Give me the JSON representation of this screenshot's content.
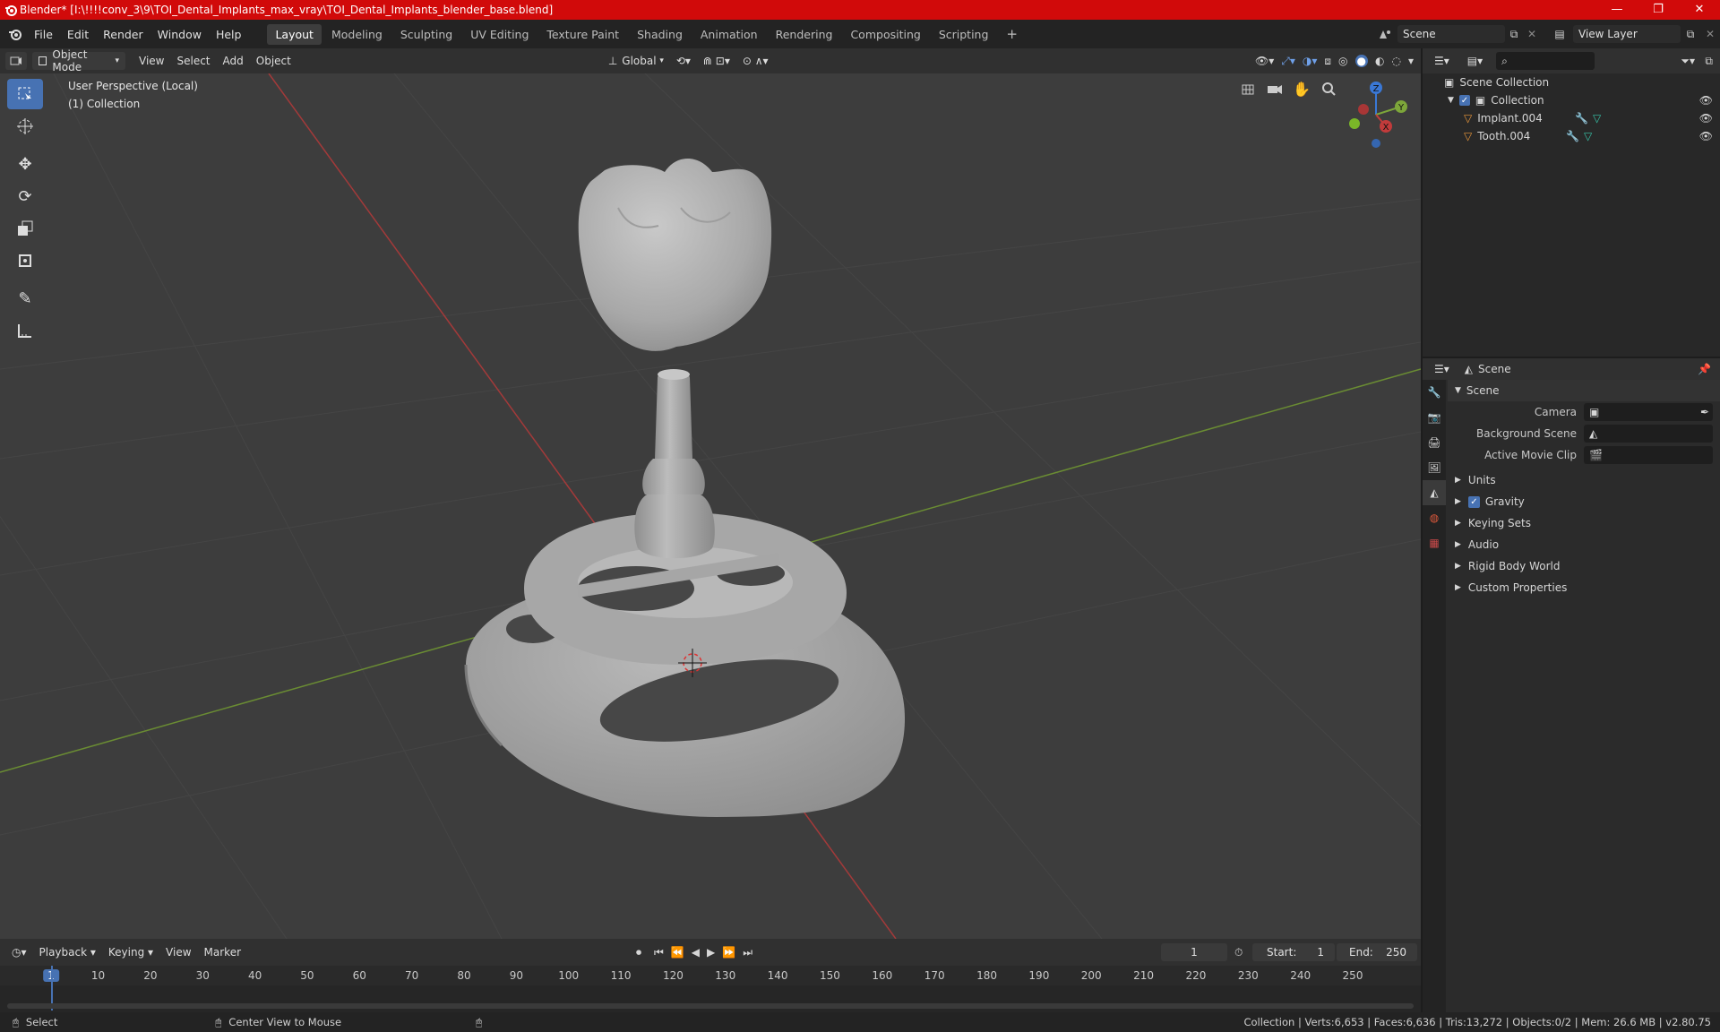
{
  "title_bar": {
    "title": "Blender* [I:\\!!!!conv_3\\9\\TOI_Dental_Implants_max_vray\\TOI_Dental_Implants_blender_base.blend]"
  },
  "menu": {
    "items": [
      "File",
      "Edit",
      "Render",
      "Window",
      "Help"
    ]
  },
  "workspaces": {
    "tabs": [
      "Layout",
      "Modeling",
      "Sculpting",
      "UV Editing",
      "Texture Paint",
      "Shading",
      "Animation",
      "Rendering",
      "Compositing",
      "Scripting"
    ],
    "active": "Layout"
  },
  "scene_selector": {
    "value": "Scene"
  },
  "view_layer": {
    "value": "View Layer"
  },
  "viewport_header": {
    "mode": "Object Mode",
    "menus": [
      "View",
      "Select",
      "Add",
      "Object"
    ],
    "orientation": "Global"
  },
  "viewport": {
    "perspective": "User Perspective (Local)",
    "collection": "(1) Collection"
  },
  "gizmo": {
    "z": "Z",
    "y": "Y",
    "x": "X"
  },
  "outliner": {
    "root": "Scene Collection",
    "collection": "Collection",
    "objects": [
      "Implant.004",
      "Tooth.004"
    ]
  },
  "properties": {
    "header": "Scene",
    "panel_title": "Scene",
    "fields": [
      {
        "label": "Camera"
      },
      {
        "label": "Background Scene"
      },
      {
        "label": "Active Movie Clip"
      }
    ],
    "sections": [
      "Units",
      "Gravity",
      "Keying Sets",
      "Audio",
      "Rigid Body World",
      "Custom Properties"
    ],
    "gravity_checked": true
  },
  "timeline": {
    "menus": [
      "Playback",
      "Keying",
      "View",
      "Marker"
    ],
    "current_frame": "1",
    "start_label": "Start:",
    "start": "1",
    "end_label": "End:",
    "end": "250",
    "ruler_labels": [
      "1",
      "10",
      "20",
      "30",
      "40",
      "50",
      "60",
      "70",
      "80",
      "90",
      "100",
      "110",
      "120",
      "130",
      "140",
      "150",
      "160",
      "170",
      "180",
      "190",
      "200",
      "210",
      "220",
      "230",
      "240",
      "250"
    ],
    "ruler_values": [
      1,
      10,
      20,
      30,
      40,
      50,
      60,
      70,
      80,
      90,
      100,
      110,
      120,
      130,
      140,
      150,
      160,
      170,
      180,
      190,
      200,
      210,
      220,
      230,
      240,
      250
    ]
  },
  "statusbar": {
    "left": "Select",
    "middle": "Center View to Mouse",
    "stats": "Collection | Verts:6,653 | Faces:6,636 | Tris:13,272 | Objects:0/2 | Mem: 26.6 MB | v2.80.75"
  },
  "colors": {
    "accent": "#4772b3",
    "title_bar": "#d10a0a",
    "viewport_bg": "#3d3d3d",
    "x_axis": "#c23b3b",
    "y_axis": "#7da63a"
  }
}
